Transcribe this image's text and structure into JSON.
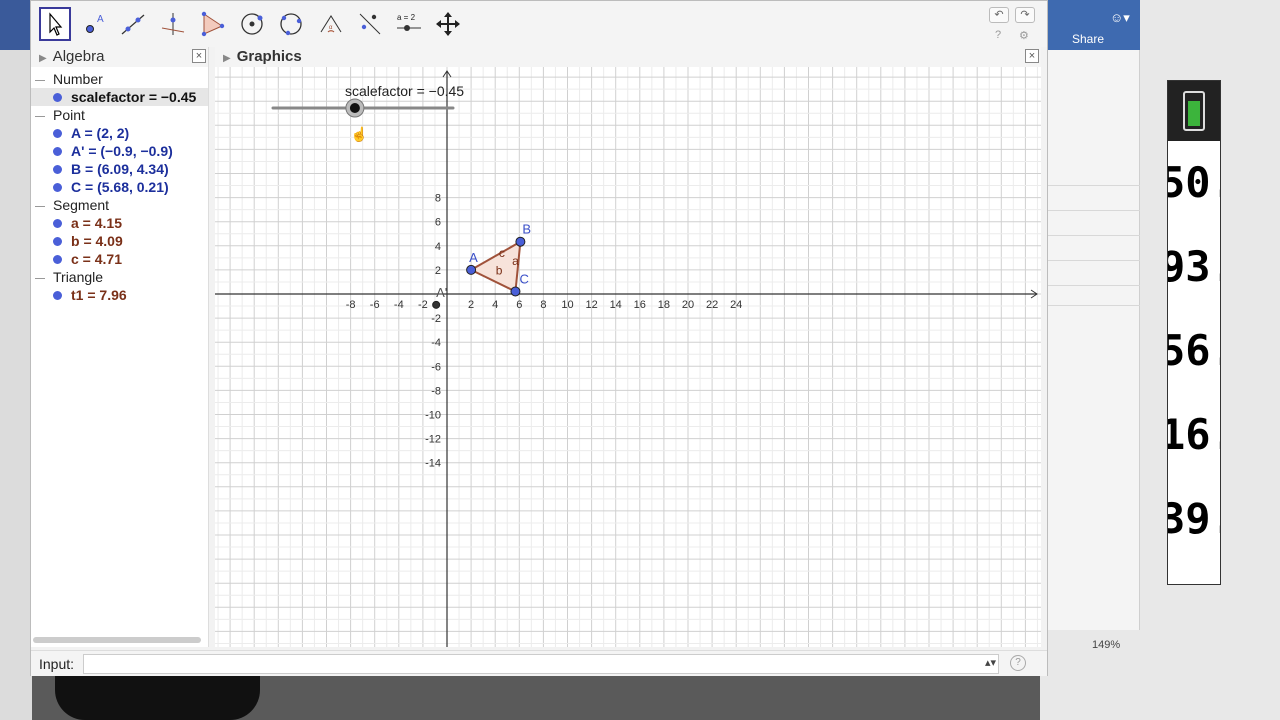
{
  "toolbar": {
    "tools": [
      "move-tool",
      "point-tool",
      "line-tool",
      "perpendicular-tool",
      "polygon-tool",
      "circle-tool",
      "conic-tool",
      "angle-tool",
      "reflect-tool",
      "slider-tool",
      "move-view-tool"
    ],
    "slider_label": "a = 2"
  },
  "algebra": {
    "title": "Algebra",
    "categories": [
      {
        "name": "Number",
        "items": [
          {
            "text": "scalefactor = −0.45",
            "color": "#111111"
          }
        ]
      },
      {
        "name": "Point",
        "items": [
          {
            "text": "A = (2, 2)",
            "color": "#1c2f9c"
          },
          {
            "text": "A' = (−0.9, −0.9)",
            "color": "#1c2f9c"
          },
          {
            "text": "B = (6.09, 4.34)",
            "color": "#1c2f9c"
          },
          {
            "text": "C = (5.68, 0.21)",
            "color": "#1c2f9c"
          }
        ]
      },
      {
        "name": "Segment",
        "items": [
          {
            "text": "a = 4.15",
            "color": "#7a3018"
          },
          {
            "text": "b = 4.09",
            "color": "#7a3018"
          },
          {
            "text": "c = 4.71",
            "color": "#7a3018"
          }
        ]
      },
      {
        "name": "Triangle",
        "items": [
          {
            "text": "t1 = 7.96",
            "color": "#7a3018"
          }
        ]
      }
    ]
  },
  "graphics": {
    "title": "Graphics",
    "slider": {
      "label": "scalefactor = −0.45",
      "value": -0.45
    },
    "x_ticks": [
      "-8",
      "-6",
      "-4",
      "-2",
      "2",
      "4",
      "6",
      "8",
      "10",
      "12",
      "14",
      "16",
      "18",
      "20",
      "22",
      "24"
    ],
    "y_ticks": [
      "8",
      "6",
      "4",
      "2",
      "-2",
      "-4",
      "-6",
      "-8",
      "-10",
      "-12",
      "-14"
    ],
    "points": [
      {
        "name": "A",
        "x": 2,
        "y": 2
      },
      {
        "name": "B",
        "x": 6.09,
        "y": 4.34
      },
      {
        "name": "C",
        "x": 5.68,
        "y": 0.21
      },
      {
        "name": "A'",
        "x": -0.9,
        "y": -0.9
      }
    ],
    "segment_labels": [
      "a",
      "b",
      "c"
    ]
  },
  "input": {
    "label": "Input:",
    "value": ""
  },
  "background": {
    "share_label": "Share",
    "zoom": "149%",
    "phone_numbers": [
      "50.",
      "93.",
      "56.",
      "16.",
      "39."
    ]
  },
  "colors": {
    "accent": "#3a3a9a",
    "point": "#4a5fd8",
    "triangle_fill": "#f7e3da",
    "triangle_stroke": "#a0523a"
  }
}
